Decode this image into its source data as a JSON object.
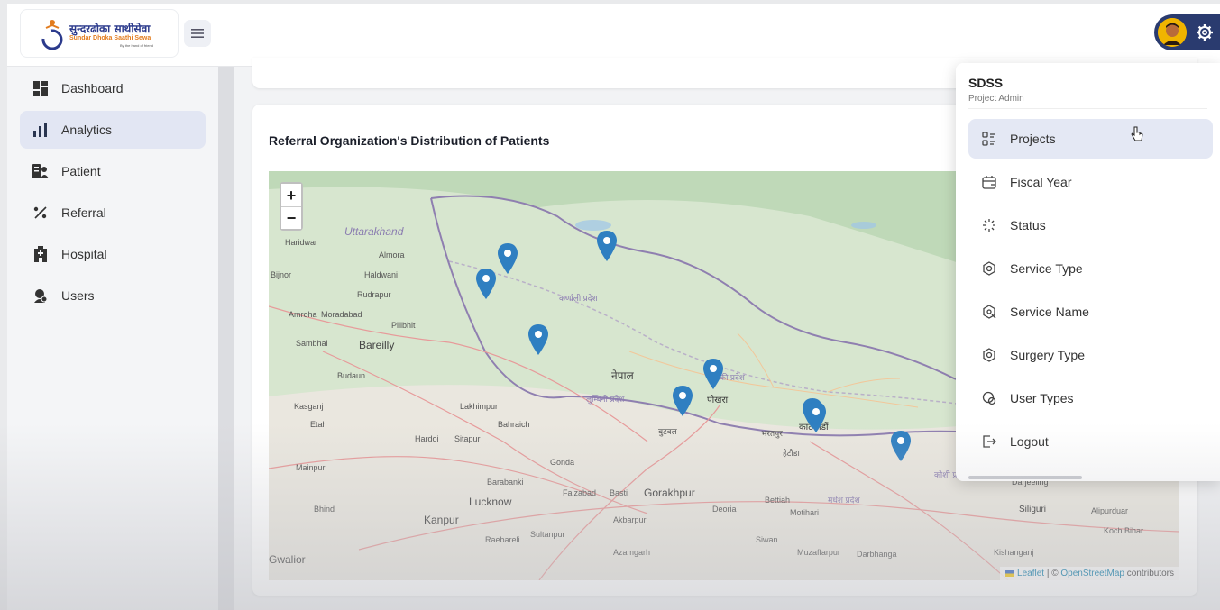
{
  "brand": {
    "title_np": "सुन्दरढोका साथीसेवा",
    "title_en": "Sundar Dhoka Saathi Sewa",
    "tagline": "By the hand of friend",
    "accent": "#2b3a8c",
    "secondary": "#e27c1e"
  },
  "header": {
    "menu_icon": "hamburger-icon",
    "settings_icon": "gear-icon"
  },
  "sidebar": {
    "items": [
      {
        "label": "Dashboard",
        "icon": "dashboard-grid-icon"
      },
      {
        "label": "Analytics",
        "icon": "bar-chart-icon",
        "active": true
      },
      {
        "label": "Patient",
        "icon": "patient-icon"
      },
      {
        "label": "Referral",
        "icon": "referral-icon"
      },
      {
        "label": "Hospital",
        "icon": "hospital-icon"
      },
      {
        "label": "Users",
        "icon": "users-icon"
      }
    ]
  },
  "main": {
    "map_card": {
      "title": "Referral Organization's Distribution of Patients",
      "zoom_in": "+",
      "zoom_out": "−",
      "attribution_leaflet": "Leaflet",
      "attribution_sep": " | © ",
      "attribution_osm": "OpenStreetMap",
      "attribution_tail": " contributors",
      "labels": {
        "uttarakhand": "Uttarakhand",
        "haridwar": "Haridwar",
        "almora": "Almora",
        "bijnor": "Bijnor",
        "haldwani": "Haldwani",
        "rudrapur": "Rudrapur",
        "amroha": "Amroha",
        "moradabad": "Moradabad",
        "pilibhit": "Pilibhit",
        "sambhal": "Sambhal",
        "bareilly": "Bareilly",
        "budaun": "Budaun",
        "kasganj": "Kasganj",
        "etah": "Etah",
        "lakhimpur": "Lakhimpur",
        "bahraich": "Bahraich",
        "hardoi": "Hardoi",
        "sitapur": "Sitapur",
        "gonda": "Gonda",
        "mainpuri": "Mainpuri",
        "barabanki": "Barabanki",
        "faizabad": "Faizabad",
        "basti": "Basti",
        "gorakhpur": "Gorakhpur",
        "lucknow": "Lucknow",
        "bhind": "Bhind",
        "kanpur": "Kanpur",
        "akbarpur": "Akbarpur",
        "deoria": "Deoria",
        "bettiah": "Bettiah",
        "motihari": "Motihari",
        "raebareli": "Raebareli",
        "sultanpur": "Sultanpur",
        "azamgarh": "Azamgarh",
        "siwan": "Siwan",
        "muzaffarpur": "Muzaffarpur",
        "darbhanga": "Darbhanga",
        "gwalior": "Gwalior",
        "kishanganj": "Kishanganj",
        "darjeeling": "Darjeeling",
        "siliguri": "Siliguri",
        "alipurduar": "Alipurduar",
        "koch_bihar": "Koch Bihar",
        "nepal": "नेपाल",
        "pokhara": "पोखरा",
        "kathmandu": "काठमाडौं",
        "karnali": "कर्णाली प्रदेश",
        "lumbini": "लुम्बिनी प्रदेश",
        "butwal": "बुटवल",
        "bharatpur": "भरतपुर",
        "hetauda": "हेटौडा",
        "gandaki": "गण्डकी प्रदेश",
        "madhesh": "मधेश प्रदेश",
        "koshi": "कोशी प्रदेश"
      },
      "marker_color": "#2f7fc1",
      "marker_count": 9
    }
  },
  "dropdown": {
    "name": "SDSS",
    "role": "Project Admin",
    "items": [
      {
        "label": "Projects",
        "icon": "list-grid-icon",
        "hover": true
      },
      {
        "label": "Fiscal Year",
        "icon": "calendar-icon"
      },
      {
        "label": "Status",
        "icon": "loader-icon"
      },
      {
        "label": "Service Type",
        "icon": "service-ring-icon"
      },
      {
        "label": "Service Name",
        "icon": "service-gear-icon"
      },
      {
        "label": "Surgery Type",
        "icon": "surgery-ring-icon"
      },
      {
        "label": "User Types",
        "icon": "user-types-icon"
      },
      {
        "label": "Logout",
        "icon": "logout-icon"
      }
    ]
  }
}
